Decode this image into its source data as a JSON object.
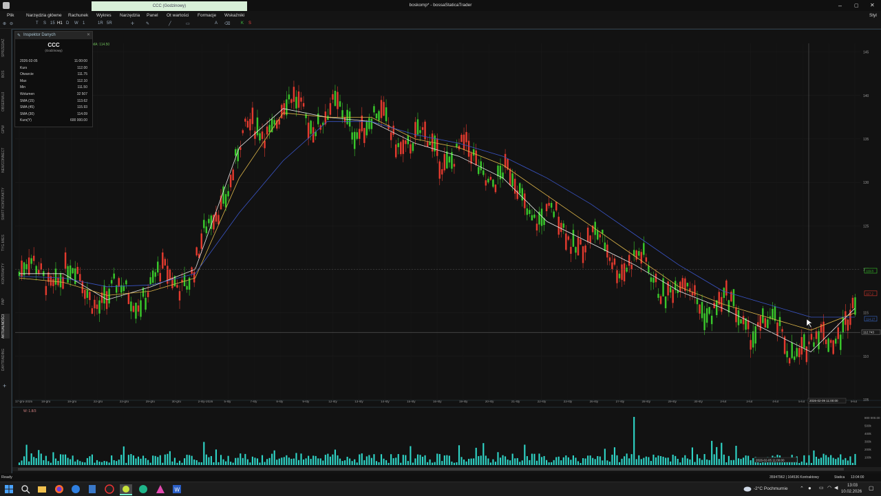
{
  "window": {
    "app_icon": "bossa-logo-icon",
    "tab_label": "CCC (Godzinowy)",
    "title": "boskomp* - bossaStaticaTrader",
    "controls": [
      "minimize-icon",
      "restore-icon",
      "close-icon"
    ]
  },
  "menu": {
    "items": [
      "Plik",
      "Narzędzia główne",
      "Rachunek",
      "Wykres",
      "Narzędzia",
      "Panel",
      "Ot wartości",
      "Formacje",
      "Wskaźniki"
    ],
    "right_label": "Styl"
  },
  "toolbar": {
    "intervals": [
      "T",
      "S",
      "15",
      "H1",
      "D",
      "W",
      "1",
      "1R",
      "5R"
    ]
  },
  "sidebar": {
    "items": [
      "SPRZEDAŻ",
      "BOS",
      "OBSERWUJ",
      "GPW",
      "NEWCONNECT",
      "SWIFT KONTRAKTY",
      "TYG.MIES",
      "KONTRAKTY",
      "PAP",
      "AKTUALNOŚCI",
      "DAYTRADING"
    ],
    "add_icon": "plus-icon"
  },
  "inspector": {
    "title": "Inspektor Danych",
    "symbol": "CCC",
    "interval": "(Godzinowy)",
    "rows": [
      {
        "label": "2026-02-05",
        "value": "11:00:00"
      },
      {
        "label": "Kurs",
        "value": "112.00"
      },
      {
        "label": "Otwarcie",
        "value": "111.75"
      },
      {
        "label": "Max",
        "value": "112.10"
      },
      {
        "label": "Min",
        "value": "111.50"
      },
      {
        "label": "Wolumen",
        "value": "32 507"
      },
      {
        "label": "SMA (15)",
        "value": "113.62"
      },
      {
        "label": "SMA (45)",
        "value": "115.93"
      },
      {
        "label": "SMA (30)",
        "value": "114.09"
      },
      {
        "label": "Kurs(Y)",
        "value": "600 000.00"
      }
    ]
  },
  "price_panel": {
    "ma_legend": "MA: 114.50",
    "y_axis_ticks": [
      "145",
      "140",
      "135",
      "130",
      "125",
      "120",
      "115",
      "110",
      "105"
    ],
    "last_price_tags": [
      "119.8",
      "117.2",
      "114.27"
    ],
    "crosshair_price_label": "112.743",
    "crosshair_time_label": "2026-02-09 11:00:00",
    "x_axis_ticks": [
      "17-gru-2025",
      "18-gru",
      "19-gru",
      "22-gru",
      "23-gru",
      "29-gru",
      "30-gru",
      "2-sty-2026",
      "5-sty",
      "7-sty",
      "8-sty",
      "9-sty",
      "12-sty",
      "13-sty",
      "14-sty",
      "15-sty",
      "16-sty",
      "19-sty",
      "20-sty",
      "21-sty",
      "22-sty",
      "23-sty",
      "26-sty",
      "27-sty",
      "28-sty",
      "29-sty",
      "30-sty",
      "2-lut",
      "3-lut",
      "4-lut",
      "5-lut",
      "6-lut",
      "9-lut"
    ]
  },
  "volume_panel": {
    "legend": "W: 1.8/3",
    "y_axis_ticks": [
      "800 000.00",
      "500k",
      "400k",
      "300k",
      "200k",
      "100k"
    ],
    "crosshair_label": "2026-02-05 11:00:00"
  },
  "statusbar": {
    "left": "Ready",
    "center": "35947962 | 164536 Kontraktowy",
    "mode": "Statica",
    "clock": "13:04:00"
  },
  "taskbar": {
    "apps": [
      "windows-start-icon",
      "search-icon",
      "file-explorer-icon",
      "firefox-icon",
      "edge-icon",
      "calculator-icon",
      "recorder-icon",
      "bossa-app-icon",
      "edge-browser-icon",
      "store-icon",
      "word-icon"
    ],
    "weather": "-2°C Pochmurnie",
    "time": "13:03",
    "date": "10.02.2026"
  },
  "colors": {
    "bull": "#39c72b",
    "bear": "#e23a2e",
    "sma_fast": "#e8e8e8",
    "sma_mid": "#e0b84a",
    "sma_slow": "#3a55c8",
    "volume": "#2fd6c8"
  },
  "chart_data": {
    "type": "line",
    "description_series": [
      {
        "name": "SMA (15)",
        "x": [
          "17-gru-2025",
          "22-gru",
          "29-gru",
          "2-sty-2026",
          "7-sty",
          "9-sty",
          "13-sty",
          "15-sty",
          "19-sty",
          "21-sty",
          "23-sty",
          "26-sty",
          "28-sty",
          "29-sty",
          "30-sty",
          "2-lut",
          "4-lut",
          "5-lut",
          "6-lut",
          "9-lut"
        ],
        "values": [
          119.5,
          119.5,
          116.5,
          118.0,
          120.0,
          134.0,
          138.5,
          137.5,
          137.0,
          134.5,
          133.0,
          130.5,
          125.5,
          123.0,
          120.5,
          117.5,
          115.5,
          113.0,
          110.5,
          115.5
        ]
      },
      {
        "name": "SMA (30)",
        "x": [
          "17-gru-2025",
          "22-gru",
          "29-gru",
          "2-sty-2026",
          "7-sty",
          "9-sty",
          "13-sty",
          "15-sty",
          "19-sty",
          "21-sty",
          "23-sty",
          "26-sty",
          "28-sty",
          "29-sty",
          "30-sty",
          "2-lut",
          "4-lut",
          "5-lut",
          "6-lut",
          "9-lut"
        ],
        "values": [
          119.0,
          118.5,
          117.0,
          117.5,
          119.0,
          130.5,
          138.0,
          137.5,
          137.5,
          135.0,
          134.0,
          132.0,
          128.5,
          125.0,
          121.5,
          118.0,
          116.0,
          114.5,
          113.0,
          115.0
        ]
      },
      {
        "name": "SMA (45)",
        "x": [
          "17-gru-2025",
          "22-gru",
          "29-gru",
          "2-sty-2026",
          "7-sty",
          "9-sty",
          "13-sty",
          "15-sty",
          "19-sty",
          "21-sty",
          "23-sty",
          "26-sty",
          "28-sty",
          "29-sty",
          "30-sty",
          "2-lut",
          "4-lut",
          "5-lut",
          "6-lut",
          "9-lut"
        ],
        "values": [
          119.2,
          119.0,
          118.0,
          118.2,
          119.5,
          126.5,
          132.5,
          137.0,
          137.0,
          135.5,
          134.5,
          133.0,
          130.5,
          127.5,
          124.0,
          120.5,
          117.5,
          116.0,
          114.5,
          114.5
        ]
      }
    ],
    "ylim": [
      105,
      146
    ],
    "xlabel": "",
    "ylabel": ""
  }
}
